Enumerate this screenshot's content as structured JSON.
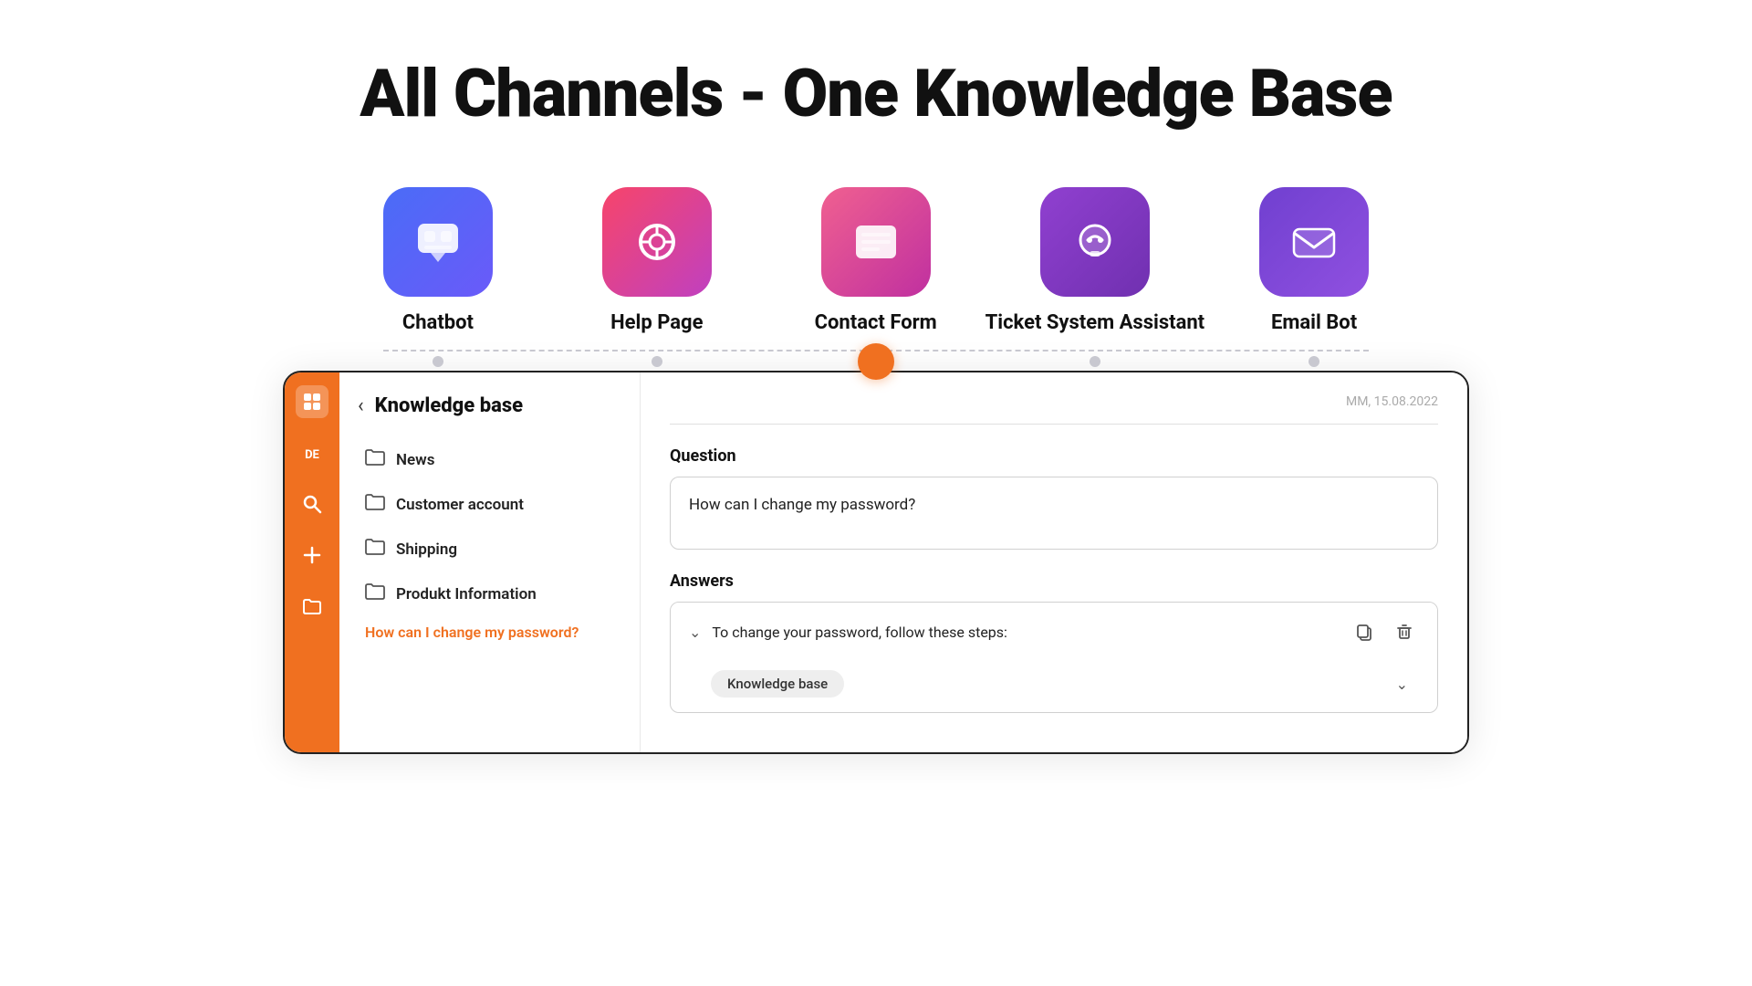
{
  "page": {
    "title": "All Channels - One Knowledge Base"
  },
  "channels": [
    {
      "id": "chatbot",
      "label": "Chatbot",
      "icon_class": "icon-chatbot",
      "active": false
    },
    {
      "id": "helppage",
      "label": "Help Page",
      "icon_class": "icon-helppage",
      "active": false
    },
    {
      "id": "contactform",
      "label": "Contact Form",
      "icon_class": "icon-contactform",
      "active": true
    },
    {
      "id": "ticketsystem",
      "label": "Ticket System Assistant",
      "icon_class": "icon-ticketsystem",
      "active": false
    },
    {
      "id": "emailbot",
      "label": "Email Bot",
      "icon_class": "icon-emailbot",
      "active": false
    }
  ],
  "mockup": {
    "sidebar": {
      "lang": "DE",
      "icons": [
        "grid",
        "search",
        "plus",
        "folder"
      ]
    },
    "nav": {
      "title": "Knowledge base",
      "back_label": "‹",
      "items": [
        "News",
        "Customer account",
        "Shipping",
        "Produkt Information"
      ],
      "active_item": "How can I change my password?"
    },
    "content": {
      "date": "MM, 15.08.2022",
      "question_label": "Question",
      "question_value": "How can I change my password?",
      "answers_label": "Answers",
      "answer_text": "To change your password, follow these steps:",
      "answer_tag": "Knowledge base"
    }
  }
}
